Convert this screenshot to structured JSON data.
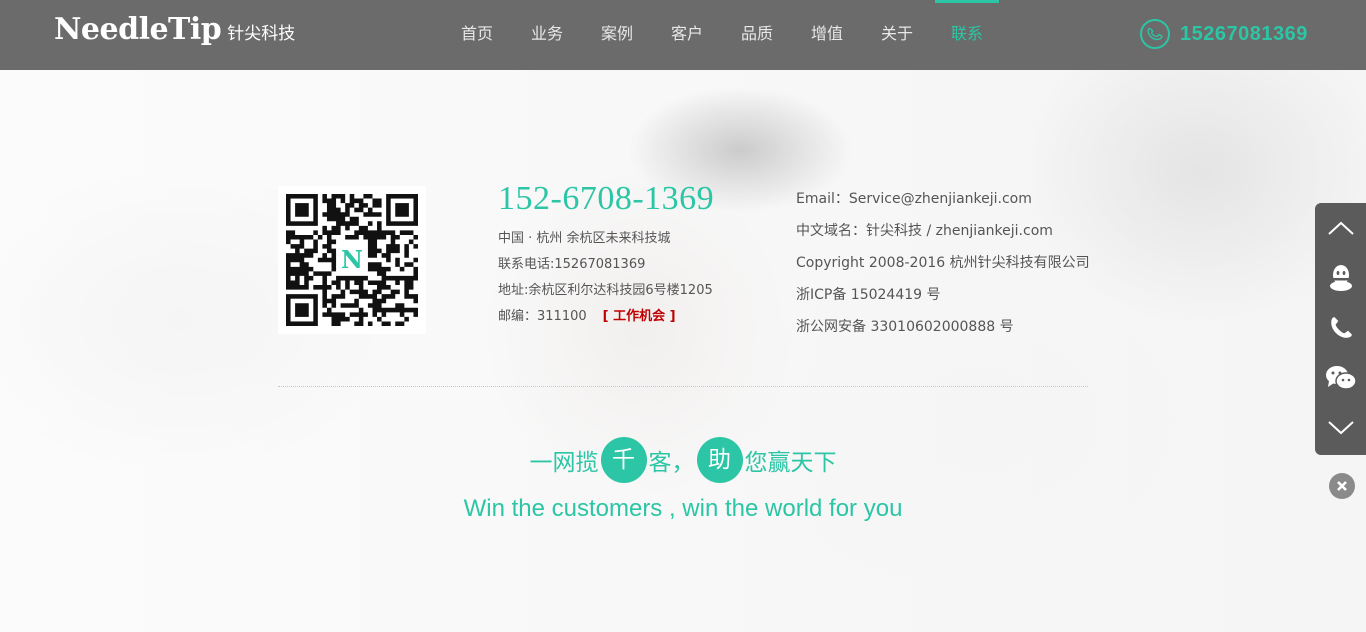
{
  "header": {
    "logo_en": "NeedleTip",
    "logo_cn": "针尖科技",
    "nav": [
      {
        "label": "首页"
      },
      {
        "label": "业务"
      },
      {
        "label": "案例"
      },
      {
        "label": "客户"
      },
      {
        "label": "品质"
      },
      {
        "label": "增值"
      },
      {
        "label": "关于"
      },
      {
        "label": "联系"
      }
    ],
    "active_nav": "联系",
    "phone": "15267081369"
  },
  "contact": {
    "qr_center_letter": "N",
    "big_phone": "152-6708-1369",
    "location": "中国 · 杭州   余杭区未来科技城",
    "tel": "联系电话:15267081369",
    "address": "地址:余杭区利尔达科技园6号楼1205",
    "postcode": "邮编：311100",
    "job_link": "[ 工作机会 ]",
    "email": "Email：Service@zhenjiankeji.com",
    "domain": "中文域名：针尖科技 / zhenjiankeji.com",
    "copyright": "Copyright 2008-2016  杭州针尖科技有限公司",
    "icp": "浙ICP备 15024419 号",
    "police": "浙公网安备 33010602000888 号"
  },
  "slogan": {
    "cn_part1": "一网揽",
    "cn_circle1": "千",
    "cn_part2": "客，",
    "cn_circle2": "助",
    "cn_part3": "您赢天下",
    "en": "Win the customers , win the world for you"
  },
  "sidebar": {
    "items": [
      "arrow-up-icon",
      "qq-icon",
      "phone-icon",
      "wechat-icon",
      "arrow-down-icon"
    ]
  },
  "colors": {
    "accent": "#2cc5a5",
    "header_bg": "#6b6b6b",
    "sidebar_bg": "#5b5b5b",
    "job_link": "#c00000"
  }
}
